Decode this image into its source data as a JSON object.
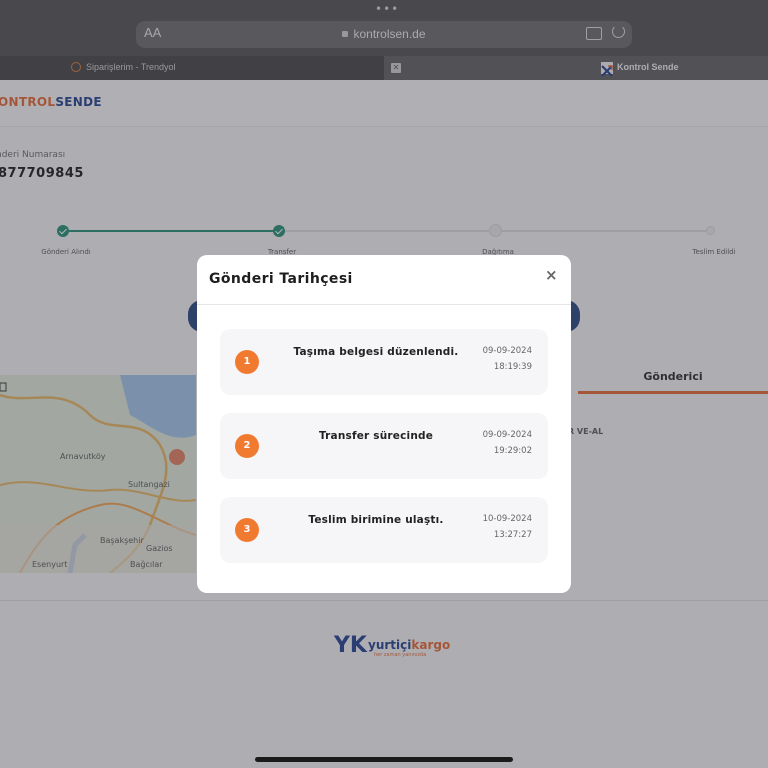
{
  "browser": {
    "url": "kontrolsen.de",
    "text_size_label": "AA",
    "tabs": [
      {
        "label": "Siparişlerim - Trendyol",
        "active": false
      },
      {
        "label": "Kontrol Sende",
        "active": true
      }
    ]
  },
  "page": {
    "logo_part1": "ONTROL",
    "logo_part2": "SENDE",
    "tracking_label": "nderi Numarası",
    "tracking_number": "877709845",
    "steps": [
      {
        "label": "Gönderi Alındı",
        "done": true
      },
      {
        "label": "Transfer",
        "done": true
      },
      {
        "label": "Dağıtıma",
        "done": false
      },
      {
        "label": "Teslim Edildi",
        "done": false
      }
    ],
    "sender_tab": "Gönderici",
    "sender_text": "İR VE-AL",
    "map_labels": [
      "Arnavutköy",
      "Sultangazi",
      "Başakşehir",
      "Gazios",
      "Esenyurt",
      "Bağcılar"
    ],
    "footer_brand_a": "yurtiçi",
    "footer_brand_b": "kargo",
    "footer_slogan": "her zaman yanınızda"
  },
  "modal": {
    "title": "Gönderi Tarihçesi",
    "close_label": "×",
    "events": [
      {
        "index": "1",
        "title": "Taşıma belgesi düzenlendi.",
        "date": "09-09-2024",
        "time": "18:19:39"
      },
      {
        "index": "2",
        "title": "Transfer sürecinde",
        "date": "09-09-2024",
        "time": "19:29:02"
      },
      {
        "index": "3",
        "title": "Teslim birimine ulaştı.",
        "date": "10-09-2024",
        "time": "13:27:27"
      }
    ]
  },
  "colors": {
    "accent_orange": "#f07a30",
    "progress_green": "#1b8b6e",
    "brand_blue": "#1a3a8a"
  }
}
